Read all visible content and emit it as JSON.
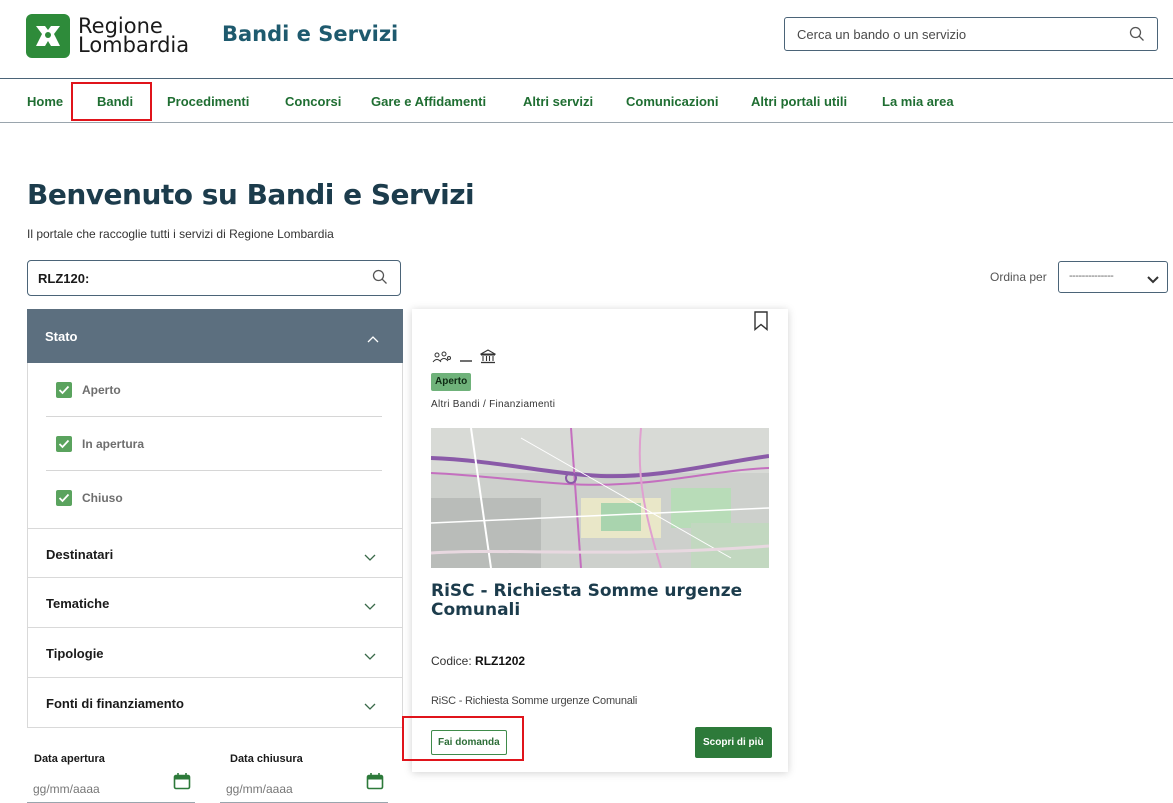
{
  "header": {
    "logo_line1": "Regione",
    "logo_line2": "Lombardia",
    "title": "Bandi e Servizi",
    "search_placeholder": "Cerca un bando o un servizio"
  },
  "nav": {
    "items": [
      "Home",
      "Bandi",
      "Procedimenti",
      "Concorsi",
      "Gare e Affidamenti",
      "Altri servizi",
      "Comunicazioni",
      "Altri portali utili",
      "La mia area"
    ],
    "highlighted": "Bandi"
  },
  "hero": {
    "title": "Benvenuto su Bandi e Servizi",
    "subtitle": "Il portale che raccoglie tutti i servizi di Regione Lombardia"
  },
  "filters": {
    "search_value": "RLZ120:",
    "sort_label": "Ordina per",
    "sort_value": "--------------",
    "stato": {
      "label": "Stato",
      "options": [
        {
          "label": "Aperto",
          "checked": true
        },
        {
          "label": "In apertura",
          "checked": true
        },
        {
          "label": "Chiuso",
          "checked": true
        }
      ]
    },
    "sections": [
      "Destinatari",
      "Tematiche",
      "Tipologie",
      "Fonti di finanziamento"
    ],
    "date_apertura_label": "Data apertura",
    "date_chiusura_label": "Data chiusura",
    "date_placeholder": "gg/mm/aaaa"
  },
  "card": {
    "badge": "Aperto",
    "category": "Altri Bandi / Finanziamenti",
    "title": "RiSC - Richiesta Somme urgenze Comunali",
    "codice_label": "Codice:",
    "codice_value": "RLZ1202",
    "description": "RiSC - Richiesta Somme urgenze Comunali",
    "btn_apply": "Fai domanda",
    "btn_more": "Scopri di più"
  },
  "colors": {
    "brand_green": "#2e8b3a",
    "nav_green": "#1f6e32",
    "heading_blue": "#1c3c4c",
    "accordion_head": "#5c6f7f",
    "highlight_red": "#e0141b"
  }
}
